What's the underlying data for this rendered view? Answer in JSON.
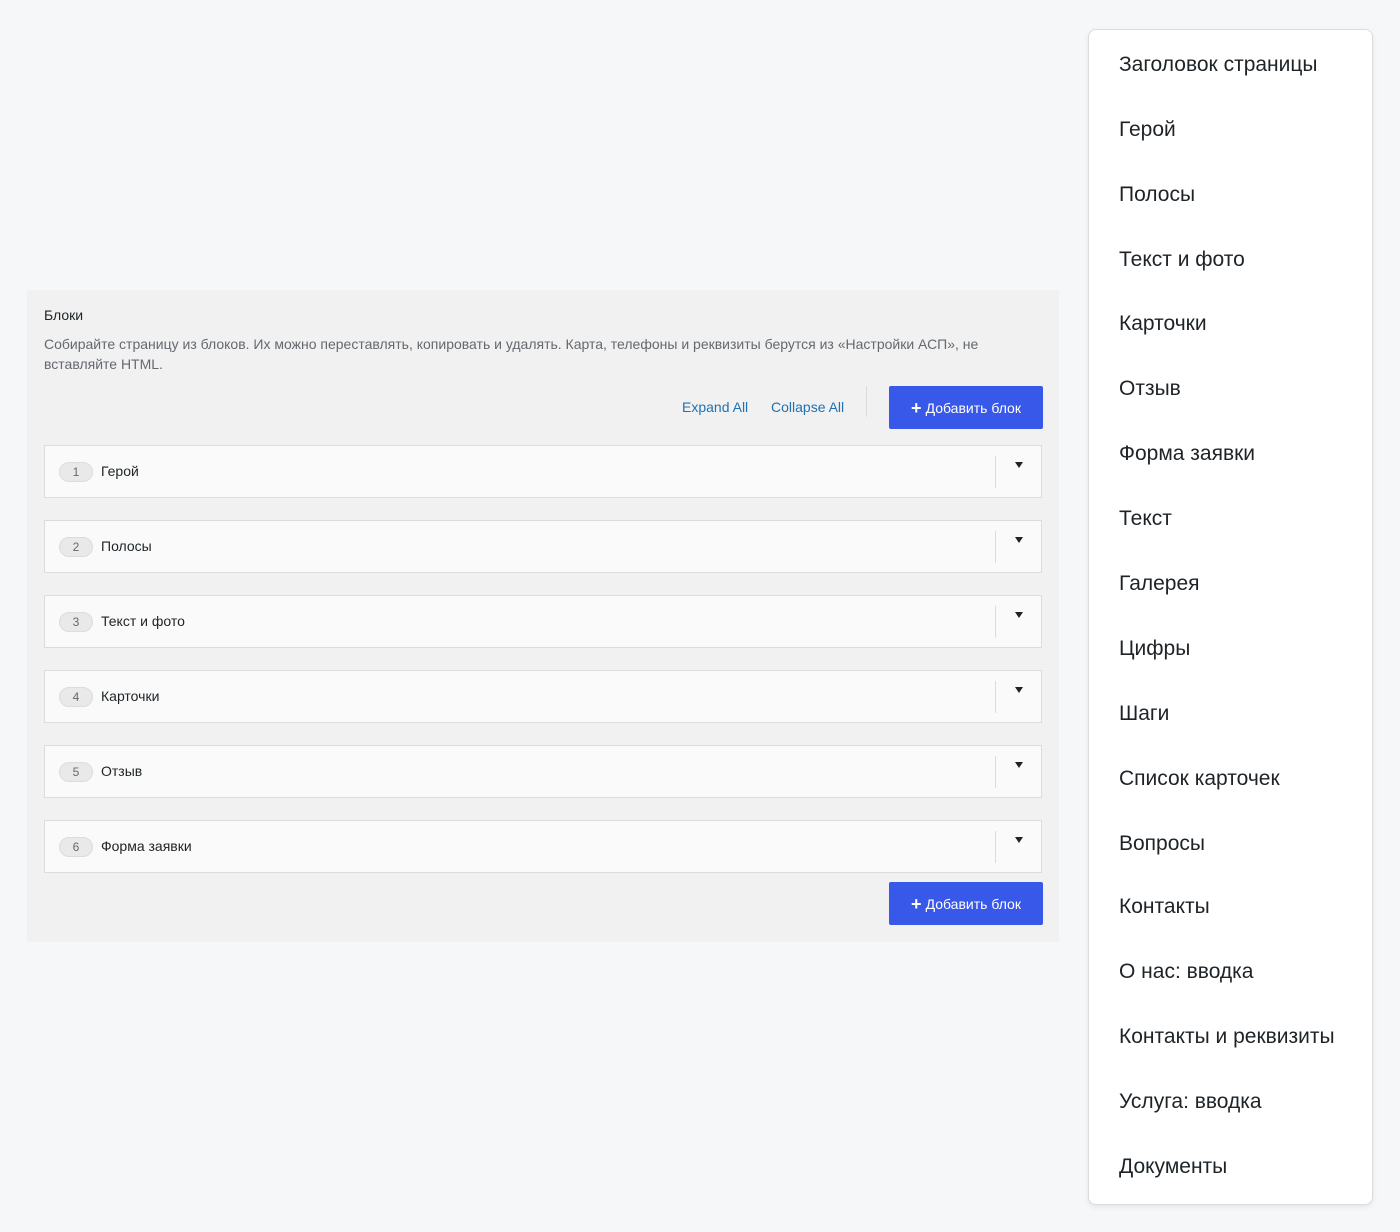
{
  "blocks": {
    "title": "Блоки",
    "description": "Собирайте страницу из блоков. Их можно переставлять, копировать и удалять. Карта, телефоны и реквизиты берутся из «Настройки АСП», не вставляйте HTML.",
    "expand_all": "Expand All",
    "collapse_all": "Collapse All",
    "add_button": "Добавить блок",
    "plus_glyph": "+",
    "rows": [
      {
        "number": "1",
        "label": "Герой"
      },
      {
        "number": "2",
        "label": "Полосы"
      },
      {
        "number": "3",
        "label": "Текст и фото"
      },
      {
        "number": "4",
        "label": "Карточки"
      },
      {
        "number": "5",
        "label": "Отзыв"
      },
      {
        "number": "6",
        "label": "Форма заявки"
      }
    ]
  },
  "dropdown": {
    "items": [
      "Заголовок страницы",
      "Герой",
      "Полосы",
      "Текст и фото",
      "Карточки",
      "Отзыв",
      "Форма заявки",
      "Текст",
      "Галерея",
      "Цифры",
      "Шаги",
      "Список карточек",
      "Вопросы",
      "Контакты",
      "О нас: вводка",
      "Контакты и реквизиты",
      "Услуга: вводка",
      "Документы"
    ]
  },
  "colors": {
    "accent": "#3858e9",
    "link": "#2271b1",
    "panel_bg": "#f1f1f1",
    "page_bg": "#f6f7f9"
  },
  "icons": {
    "add": "plus-icon",
    "toggle": "caret-down-icon"
  }
}
